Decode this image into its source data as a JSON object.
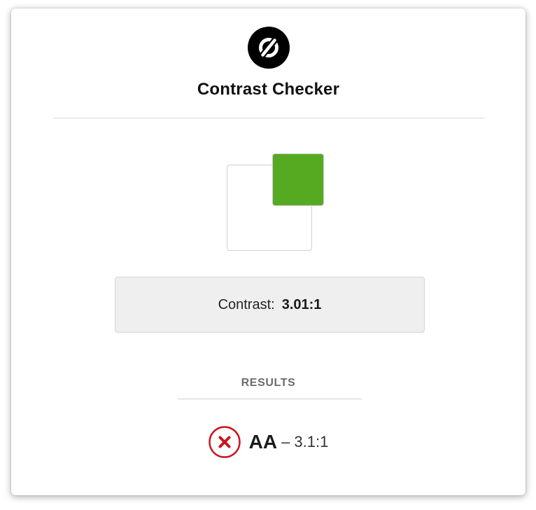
{
  "app": {
    "title": "Contrast Checker",
    "logo_icon": "logo-icon"
  },
  "colors": {
    "foreground_swatch": "#55aa22",
    "background_swatch": "#ffffff",
    "fail": "#c6161e"
  },
  "contrast": {
    "label": "Contrast:",
    "value": "3.01:1"
  },
  "results": {
    "heading": "RESULTS",
    "items": [
      {
        "level": "AA",
        "separator": "–",
        "required_ratio": "3.1:1",
        "status": "fail",
        "icon": "fail-x-icon"
      }
    ]
  }
}
